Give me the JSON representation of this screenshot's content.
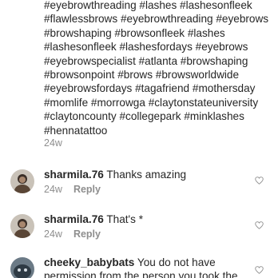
{
  "caption": {
    "text": "#eyebrowthreading #lashes #lashesonfleek #flawlessbrows #eyebrowthreading #eyebrows #browshaping #browsonfleek #lashes #lashesonfleek #lashesfordays #eyebrows #eyebrowspecialist #atlanta #browshaping #browsonpoint #brows #browsworldwide #eyebrowsfordays #tagafriend #mothersday #momlife #morrowga #claytonstateuniversity #claytoncounty #collegepark #minklashes #hennatattoo",
    "time": "24w"
  },
  "comments": [
    {
      "username": "sharmila.76",
      "text": "Thanks amazing",
      "time": "24w",
      "reply_label": "Reply",
      "avatar": "avatar-photo",
      "like_icon": "heart-outline-icon"
    },
    {
      "username": "sharmila.76",
      "text": "That's *",
      "time": "24w",
      "reply_label": "Reply",
      "avatar": "avatar-photo",
      "like_icon": "heart-outline-icon"
    },
    {
      "username": "cheeky_babybats",
      "text": "You do not have permission from the person you took the",
      "avatar": "avatar-photo",
      "like_icon": "heart-outline-icon"
    }
  ],
  "colors": {
    "text": "#262626",
    "muted": "#8e8e8e",
    "divider": "#dbdbdb"
  }
}
